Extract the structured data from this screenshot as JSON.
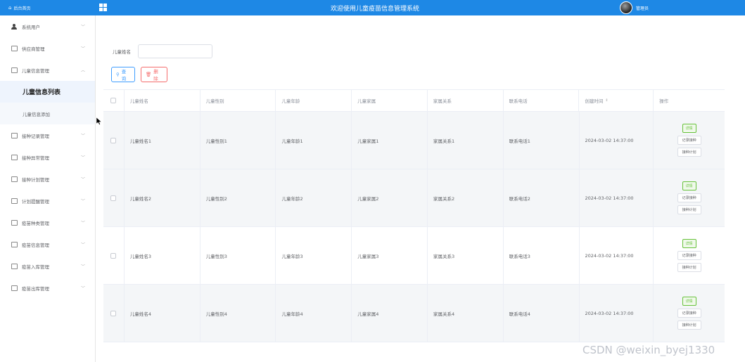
{
  "header": {
    "brand_label": "后台首页",
    "system_title": "欢迎使用儿童疫苗信息管理系统",
    "admin_name": "管理员",
    "brand_color": "#1e88e5"
  },
  "sidebar": {
    "items": [
      {
        "label": "系统用户",
        "icon": "user-icon",
        "expanded": false
      },
      {
        "label": "供应商管理",
        "icon": "doc-icon",
        "expanded": false
      },
      {
        "label": "儿童信息管理",
        "icon": "doc-icon",
        "expanded": true
      },
      {
        "label": "接种记录管理",
        "icon": "doc-icon",
        "expanded": false
      },
      {
        "label": "接种异常管理",
        "icon": "doc-icon",
        "expanded": false
      },
      {
        "label": "接种计划管理",
        "icon": "doc-icon",
        "expanded": false
      },
      {
        "label": "计划提醒管理",
        "icon": "doc-icon",
        "expanded": false
      },
      {
        "label": "疫苗种类管理",
        "icon": "doc-icon",
        "expanded": false
      },
      {
        "label": "疫苗信息管理",
        "icon": "doc-icon",
        "expanded": false
      },
      {
        "label": "疫苗入库管理",
        "icon": "doc-icon",
        "expanded": false
      },
      {
        "label": "疫苗出库管理",
        "icon": "doc-icon",
        "expanded": false
      }
    ],
    "sub_items": [
      {
        "label": "儿童信息列表",
        "active": true
      },
      {
        "label": "儿童信息添加",
        "active": false
      }
    ]
  },
  "filter": {
    "label": "儿童姓名",
    "value": "",
    "placeholder": ""
  },
  "buttons": {
    "search": "查询",
    "delete": "删除"
  },
  "table": {
    "columns": [
      "儿童姓名",
      "儿童性别",
      "儿童年龄",
      "儿童家属",
      "家属关系",
      "联系电话",
      "创建时间",
      "操作"
    ],
    "rows": [
      [
        "儿童姓名1",
        "儿童性别1",
        "儿童年龄1",
        "儿童家属1",
        "家属关系1",
        "联系电话1",
        "2024-03-02 14:37:00"
      ],
      [
        "儿童姓名2",
        "儿童性别2",
        "儿童年龄2",
        "儿童家属2",
        "家属关系2",
        "联系电话2",
        "2024-03-02 14:37:00"
      ],
      [
        "儿童姓名3",
        "儿童性别3",
        "儿童年龄3",
        "儿童家属3",
        "家属关系3",
        "联系电话3",
        "2024-03-02 14:37:00"
      ],
      [
        "儿童姓名4",
        "儿童性别4",
        "儿童年龄4",
        "儿童家属4",
        "家属关系4",
        "联系电话4",
        "2024-03-02 14:37:00"
      ]
    ],
    "row_actions": [
      "详情",
      "记录接种",
      "接种计划"
    ]
  },
  "watermark": "CSDN @weixin_byej1330"
}
